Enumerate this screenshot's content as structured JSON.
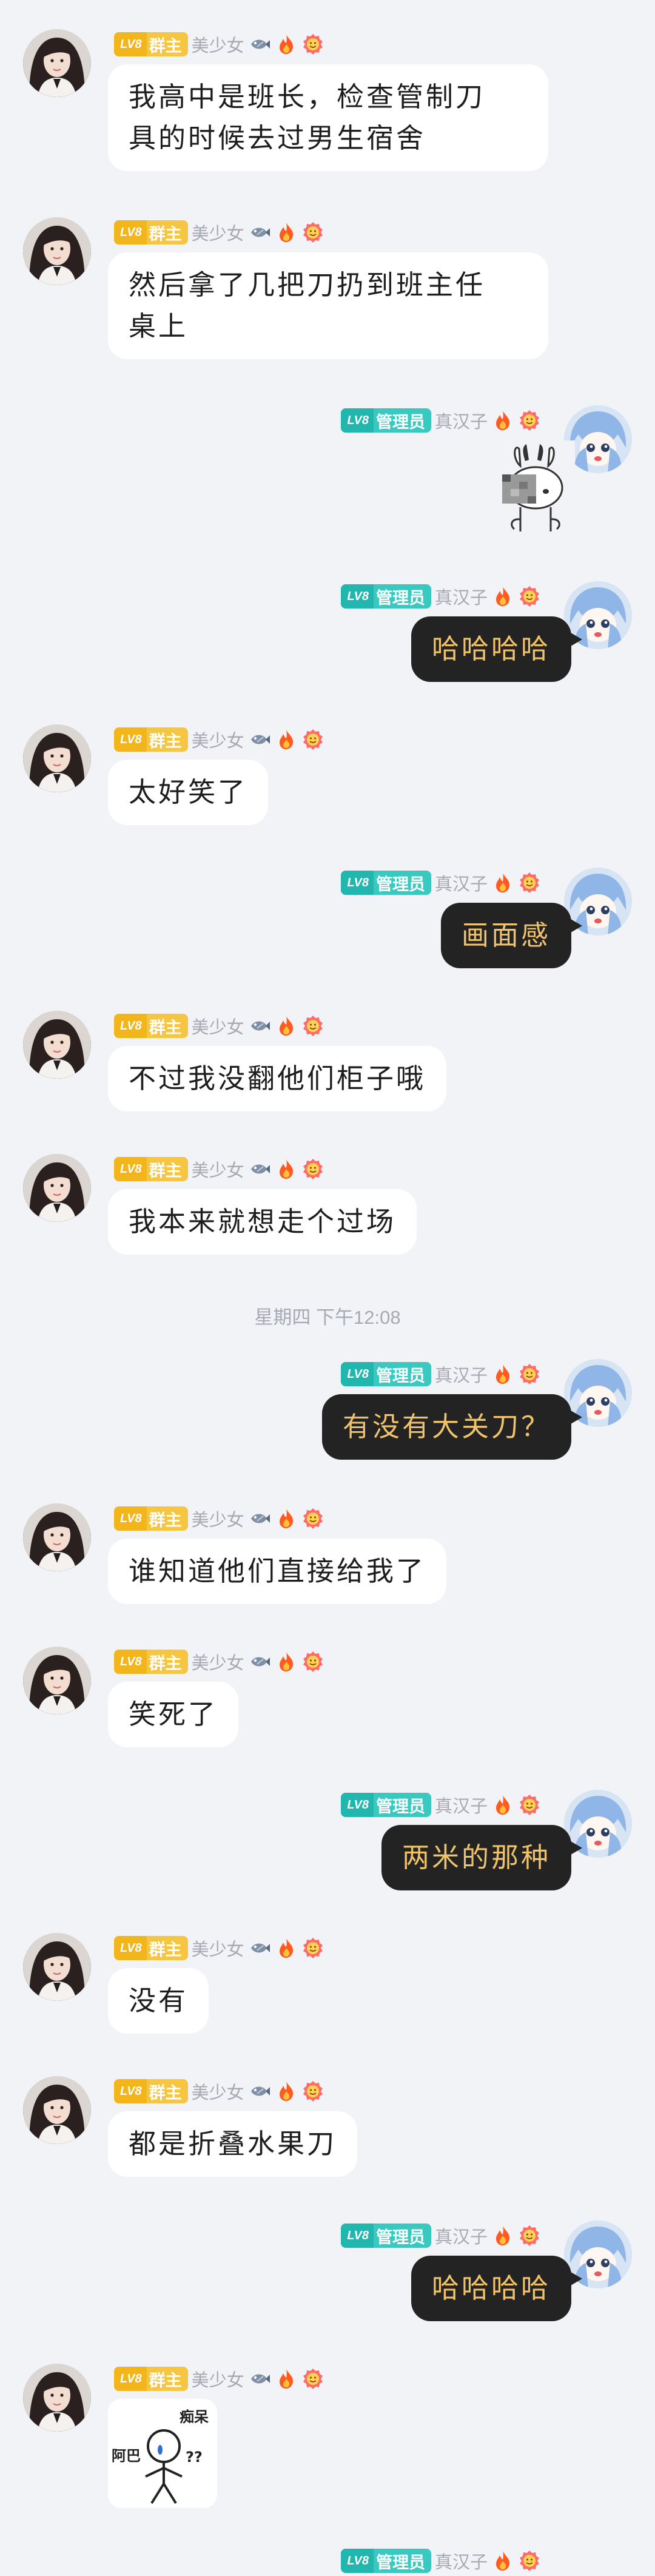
{
  "users": {
    "owner": {
      "level": "LV8",
      "role": "群主",
      "nickname": "美少女"
    },
    "admin": {
      "level": "LV8",
      "role": "管理员",
      "nickname": "真汉子"
    }
  },
  "messages": [
    {
      "side": "left",
      "text": "我高中是班长，检查管制刀\n具的时候去过男生宿舍"
    },
    {
      "side": "left",
      "text": "然后拿了几把刀扔到班主任\n桌上"
    },
    {
      "side": "right",
      "type": "sticker",
      "sticker": "rabbit-sticker"
    },
    {
      "side": "right",
      "text": "哈哈哈哈"
    },
    {
      "side": "left",
      "text": "太好笑了"
    },
    {
      "side": "right",
      "text": "画面感"
    },
    {
      "side": "left",
      "text": "不过我没翻他们柜子哦"
    },
    {
      "side": "left",
      "text": "我本来就想走个过场"
    },
    {
      "type": "time",
      "text": "星期四 下午12:08"
    },
    {
      "side": "right",
      "text": "有没有大关刀？"
    },
    {
      "side": "left",
      "text": "谁知道他们直接给我了"
    },
    {
      "side": "left",
      "text": "笑死了"
    },
    {
      "side": "right",
      "text": "两米的那种"
    },
    {
      "side": "left",
      "text": "没有"
    },
    {
      "side": "left",
      "text": "都是折叠水果刀"
    },
    {
      "side": "right",
      "text": "哈哈哈哈"
    },
    {
      "side": "left",
      "type": "sticker",
      "sticker": "stickman-sticker",
      "sticker_text": {
        "top": "痴呆",
        "left": "阿巴",
        "right": "??"
      }
    },
    {
      "side": "right",
      "type": "partial"
    }
  ],
  "colors": {
    "background": "#f2f3f7",
    "owner_badge": "#f6c542",
    "admin_badge": "#3ac9c0",
    "nickname": "#a7a9b2",
    "my_bubble": "#232323",
    "my_text": "#f0c36a",
    "their_bubble": "#ffffff"
  }
}
